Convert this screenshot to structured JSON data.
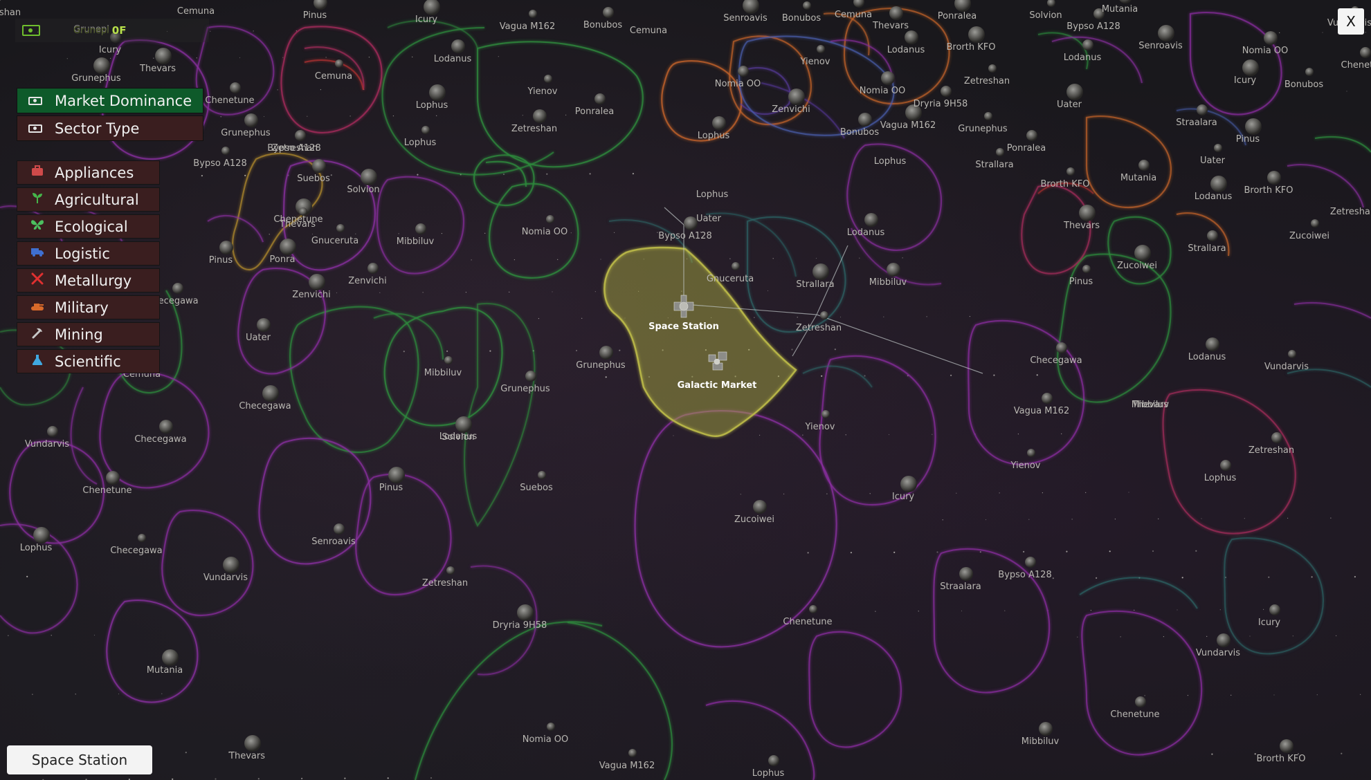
{
  "money": {
    "hint": "Grunepl",
    "value": "0F"
  },
  "modes": [
    {
      "label": "Market Dominance",
      "active": true
    },
    {
      "label": "Sector Type",
      "active": false
    }
  ],
  "sectors": [
    {
      "label": "Appliances",
      "icon": "briefcase-icon",
      "color": "#d04a4a"
    },
    {
      "label": "Agricultural",
      "icon": "sprout-icon",
      "color": "#46b54a"
    },
    {
      "label": "Ecological",
      "icon": "butterfly-icon",
      "color": "#4cc060"
    },
    {
      "label": "Logistic",
      "icon": "truck-icon",
      "color": "#3f6fd0"
    },
    {
      "label": "Metallurgy",
      "icon": "tools-icon",
      "color": "#e03030"
    },
    {
      "label": "Military",
      "icon": "tank-icon",
      "color": "#d86a2a"
    },
    {
      "label": "Mining",
      "icon": "pickaxe-icon",
      "color": "#c8c8c8"
    },
    {
      "label": "Scientific",
      "icon": "flask-icon",
      "color": "#40a8e0"
    }
  ],
  "close_label": "X",
  "selected_name": "Space Station",
  "hubs": [
    "Space Station",
    "Galactic Market"
  ],
  "planets": [
    "reshan",
    "Cemuna",
    "Pinus",
    "Icury",
    "Vagua M162",
    "Bonubos",
    "Cemuna",
    "Senroavis",
    "Bonubos",
    "Cemuna",
    "Thevars",
    "Ponralea",
    "Solvion",
    "Bypso A128",
    "Mutania",
    "Senroavis",
    "Vundarvis",
    "Icury",
    "Grunepl",
    "Thevars",
    "Cemuna",
    "Chenetune",
    "Lodanus",
    "Grunephus",
    "Yienov",
    "Nomia OO",
    "Lodanus",
    "Brorth KFO",
    "Zetreshan",
    "Lodanus",
    "Nomia OO",
    "Icury",
    "Bonubos",
    "Chenetu",
    "Grunephus",
    "Lophus",
    "Yienov",
    "Ponralea",
    "Nomia OO",
    "Vagua M162",
    "Brorth KFO",
    "Dryria 9H58",
    "Zetreshan",
    "Uater",
    "Bypso A128",
    "Zetreshan",
    "Bonubos",
    "Zenvichi",
    "Grunephus",
    "Ponralea",
    "Lophus",
    "Pinus",
    "Uater",
    "Bypso A128",
    "Suebos",
    "Solvion",
    "Lophus",
    "Straalara",
    "Lophus",
    "Lodanus",
    "Strallara",
    "Mutania",
    "Brorth KFO",
    "Chenetune",
    "Nomia OO",
    "Uater",
    "Lodanus",
    "Thevars",
    "Zucoiwei",
    "Zetreshan",
    "Pinus",
    "Ponra",
    "Gnuceruta",
    "Mibbiluv",
    "Bypso A128",
    "Strallara",
    "Gnuceruta",
    "Zenvichi",
    "Lophus",
    "Zucoiwei",
    "Pinus",
    "Strallara",
    "Mibbiluv",
    "Zenvichi",
    "Thevars",
    "Checegawa",
    "Uater",
    "Mibbiluv",
    "Vundarvis",
    "Checegawa",
    "Lodanus",
    "Cemuna",
    "Mibbiluv",
    "Grunephus",
    "Grunephus",
    "Checegawa",
    "Zetreshan",
    "Vagua M162",
    "Checegawa",
    "Solvion",
    "Yienov",
    "Vundarvis",
    "Lodanus",
    "Icury",
    "Yienov",
    "Lophus",
    "Chenetune",
    "Pinus",
    "Suebos",
    "Zetreshan",
    "Thevars",
    "Lophus",
    "Checegawa",
    "Senroavis",
    "Zucoiwei",
    "Vundarvis",
    "Zetreshan",
    "Bypso A128",
    "Straalara",
    "Dryria 9H58",
    "Chenetune",
    "Icury",
    "Vundarvis",
    "Mutania",
    "Nomia OO",
    "Chenetune",
    "Mibbiluv",
    "Thevars",
    "Vagua M162",
    "Lophus",
    "Brorth KFO",
    "Mibbiluv",
    "Solvion"
  ],
  "colors": {
    "market_dominance_active": "#0e5a2a",
    "market_dominance_bg": "#3a1e1f",
    "selected_region": "#b5b346",
    "cash_green": "#6fbe2d"
  }
}
